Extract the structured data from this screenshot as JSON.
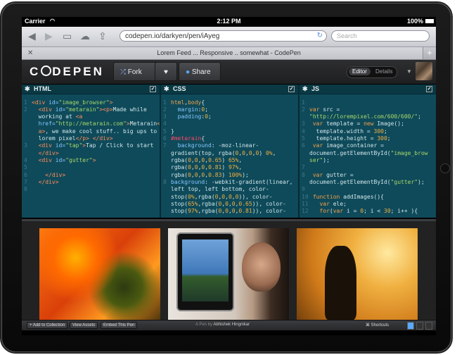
{
  "status_bar": {
    "carrier": "Carrier",
    "time": "2:12 PM",
    "battery": "100%"
  },
  "browser": {
    "url": "codepen.io/darkyen/pen/iAyeg",
    "search_placeholder": "Search",
    "tab_title": "Lorem Feed ... Responsive .. somewhat - CodePen",
    "icons": [
      "back-icon",
      "forward-icon",
      "bookmarks-icon",
      "icloud-icon",
      "share-icon",
      "reload-icon",
      "close-icon",
      "add-tab-icon"
    ]
  },
  "codepen": {
    "logo": "CODEPEN",
    "fork_label": "Fork",
    "heart_label": "♥",
    "share_label": "Share",
    "toggle_editor": "Editor",
    "toggle_details": "Details"
  },
  "panes": {
    "html": {
      "title": "HTML"
    },
    "css": {
      "title": "CSS"
    },
    "js": {
      "title": "JS"
    }
  },
  "footer": {
    "add_to_collection": "+ Add to Collection",
    "view_assets": "View Assets",
    "embed": "Embed This Pen",
    "credit_prefix": "A Pen by",
    "credit_author": "Abhishek Hingnikar",
    "shortcuts": "⌘ Shortcuts"
  },
  "colors": {
    "editor_bg": "#0f4a5a",
    "header_bg": "#1e1f21",
    "accent": "#5aa9ff"
  }
}
